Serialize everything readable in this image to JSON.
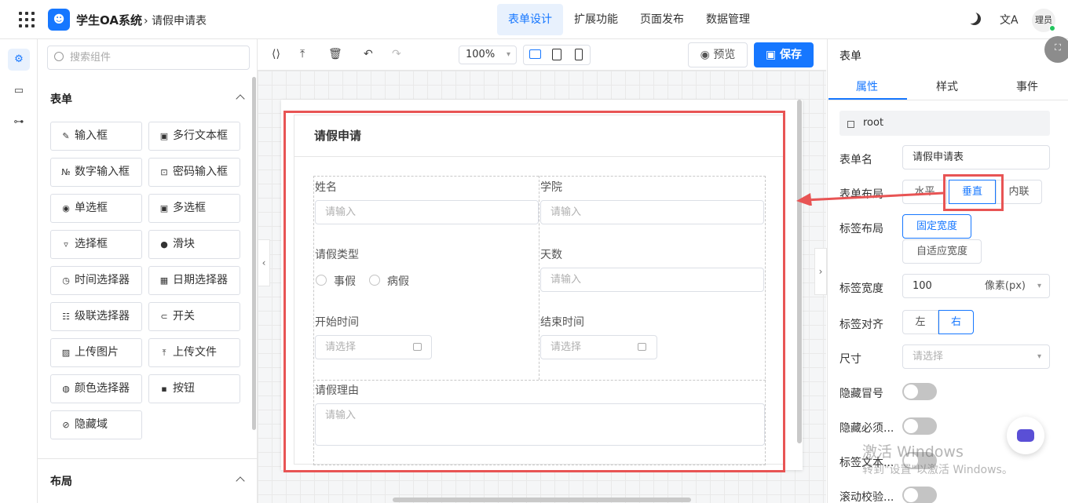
{
  "header": {
    "app_name": "学生OA系统",
    "breadcrumb": "请假申请表",
    "nav": [
      "表单设计",
      "扩展功能",
      "页面发布",
      "数据管理"
    ],
    "nav_active": 0,
    "translate_glyph": "文A",
    "user": "理员"
  },
  "components": {
    "search_placeholder": "搜索组件",
    "form_section": "表单",
    "items": [
      {
        "label": "输入框",
        "icon": "edit-icon",
        "glyph": "✎"
      },
      {
        "label": "多行文本框",
        "icon": "textarea-icon",
        "glyph": "▣"
      },
      {
        "label": "数字输入框",
        "icon": "number-icon",
        "glyph": "№"
      },
      {
        "label": "密码输入框",
        "icon": "lock-icon",
        "glyph": "🔒"
      },
      {
        "label": "单选框",
        "icon": "radio-icon",
        "glyph": "◉"
      },
      {
        "label": "多选框",
        "icon": "checkbox-icon",
        "glyph": "▣"
      },
      {
        "label": "选择框",
        "icon": "select-icon",
        "glyph": "▿"
      },
      {
        "label": "滑块",
        "icon": "slider-icon",
        "glyph": "●─"
      },
      {
        "label": "时间选择器",
        "icon": "clock-icon",
        "glyph": "◷"
      },
      {
        "label": "日期选择器",
        "icon": "calendar-icon",
        "glyph": "▦"
      },
      {
        "label": "级联选择器",
        "icon": "cascader-icon",
        "glyph": "☷"
      },
      {
        "label": "开关",
        "icon": "switch-icon",
        "glyph": "⊂⊃"
      },
      {
        "label": "上传图片",
        "icon": "image-icon",
        "glyph": "▨"
      },
      {
        "label": "上传文件",
        "icon": "upload-icon",
        "glyph": "⤒"
      },
      {
        "label": "颜色选择器",
        "icon": "palette-icon",
        "glyph": "◍"
      },
      {
        "label": "按钮",
        "icon": "button-icon",
        "glyph": "[▪]"
      },
      {
        "label": "隐藏域",
        "icon": "eye-off-icon",
        "glyph": "⊘"
      }
    ],
    "layout_section": "布局"
  },
  "toolbar": {
    "zoom": "100%",
    "preview": "预览",
    "save": "保存"
  },
  "form": {
    "title": "请假申请",
    "name_label": "姓名",
    "name_placeholder": "请输入",
    "college_label": "学院",
    "college_placeholder": "请输入",
    "leave_type_label": "请假类型",
    "leave_type_options": [
      "事假",
      "病假"
    ],
    "days_label": "天数",
    "days_placeholder": "请输入",
    "start_label": "开始时间",
    "start_placeholder": "请选择",
    "end_label": "结束时间",
    "end_placeholder": "请选择",
    "reason_label": "请假理由",
    "reason_placeholder": "请输入"
  },
  "props": {
    "panel_title": "表单",
    "tabs": [
      "属性",
      "样式",
      "事件"
    ],
    "tab_active": 0,
    "root": "root",
    "form_name_label": "表单名",
    "form_name_value": "请假申请表",
    "form_layout_label": "表单布局",
    "form_layout_options": [
      "水平",
      "垂直",
      "内联"
    ],
    "form_layout_active": 1,
    "label_layout_label": "标签布局",
    "label_layout_options": [
      "固定宽度",
      "自适应宽度"
    ],
    "label_layout_active": 0,
    "label_width_label": "标签宽度",
    "label_width_value": "100",
    "label_width_unit": "像素(px)",
    "label_align_label": "标签对齐",
    "label_align_options": [
      "左",
      "右"
    ],
    "label_align_active": 1,
    "size_label": "尺寸",
    "size_placeholder": "请选择",
    "hide_colon_label": "隐藏冒号",
    "hide_required_label": "隐藏必须...",
    "label_text_label": "标签文本...",
    "scroll_validate_label": "滚动校验..."
  },
  "watermark": {
    "line1": "激活 Windows",
    "line2": "转到\"设置\"以激活 Windows。"
  },
  "colors": {
    "accent": "#1677ff",
    "highlight": "#e85454"
  }
}
